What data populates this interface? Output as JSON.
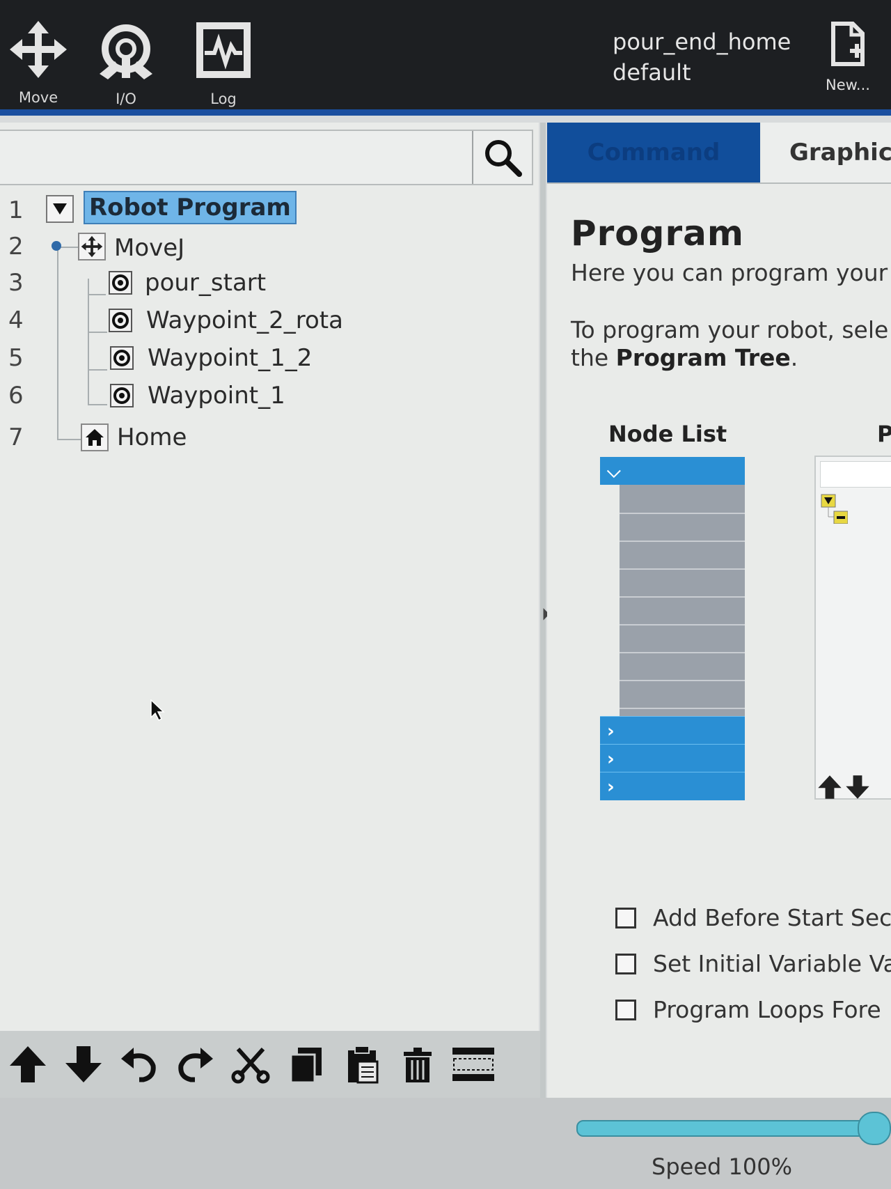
{
  "toolbar": {
    "move_label": "Move",
    "io_label": "I/O",
    "log_label": "Log",
    "program_name": "pour_end_home",
    "installation_name": "default",
    "new_label": "New..."
  },
  "search": {
    "placeholder": ""
  },
  "tree": {
    "line_numbers": [
      "1",
      "2",
      "3",
      "4",
      "5",
      "6",
      "7"
    ],
    "items": [
      {
        "label": "Robot Program",
        "icon": "collapse-triangle-icon"
      },
      {
        "label": "MoveJ",
        "icon": "move-arrows-icon"
      },
      {
        "label": "pour_start",
        "icon": "waypoint-icon"
      },
      {
        "label": "Waypoint_2_rota",
        "icon": "waypoint-icon"
      },
      {
        "label": "Waypoint_1_2",
        "icon": "waypoint-icon"
      },
      {
        "label": "Waypoint_1",
        "icon": "waypoint-icon"
      },
      {
        "label": "Home",
        "icon": "home-icon"
      }
    ]
  },
  "tree_toolbar": {
    "icons": [
      "move-up-icon",
      "move-down-icon",
      "undo-icon",
      "redo-icon",
      "cut-icon",
      "copy-icon",
      "paste-icon",
      "delete-icon",
      "suppress-icon"
    ]
  },
  "tabs": {
    "command": "Command",
    "graphics": "Graphic"
  },
  "program_panel": {
    "heading": "Program",
    "line1": "Here you can program your",
    "line2": "To program your robot, sele",
    "line3_prefix": "the ",
    "line3_bold": "Program Tree",
    "line3_suffix": ".",
    "node_list_title": "Node List",
    "preview_title": "P",
    "checkboxes": [
      {
        "label": "Add Before Start Sec",
        "checked": false
      },
      {
        "label": "Set Initial Variable Va",
        "checked": false
      },
      {
        "label": "Program Loops Fore",
        "checked": false
      }
    ]
  },
  "speed": {
    "label": "Speed 100%",
    "value_percent": 100
  },
  "colors": {
    "accent_blue": "#114e9b",
    "selection": "#6fb5e8",
    "node_list_blue": "#2a8fd4",
    "slider": "#5cc3d6"
  }
}
